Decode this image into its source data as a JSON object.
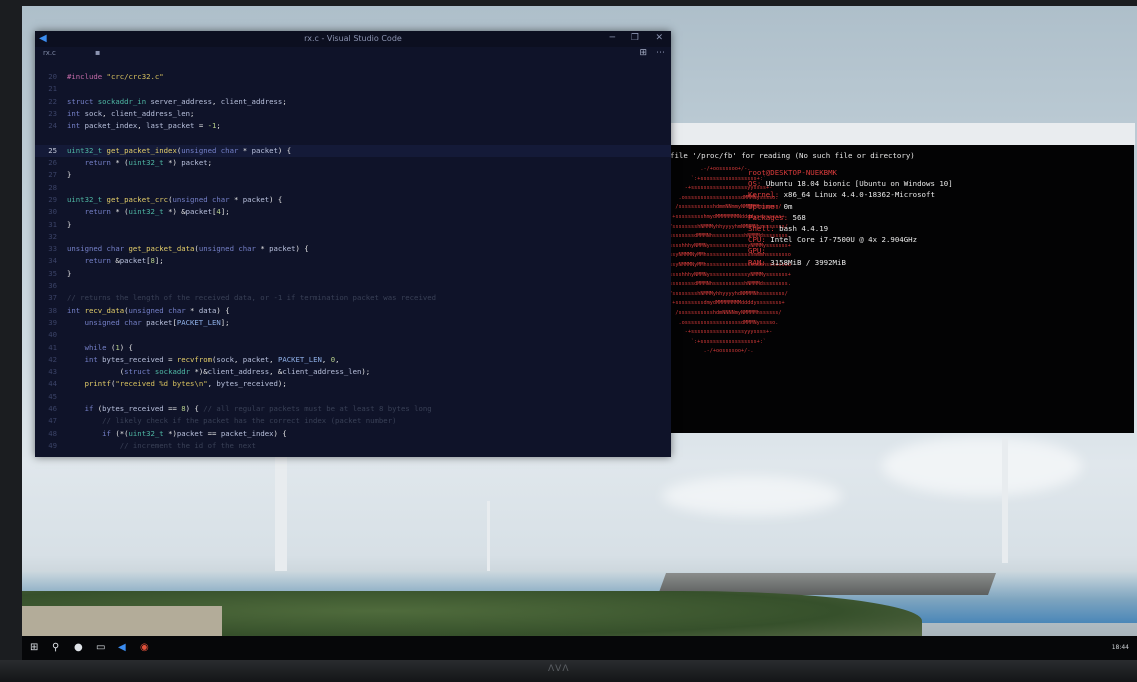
{
  "vscode": {
    "title": "rx.c - Visual Studio Code",
    "tab_label": "rx.c",
    "lines": [
      {
        "n": "20",
        "segs": [
          [
            "pre",
            "#include "
          ],
          [
            "str",
            "\"crc/crc32.c\""
          ]
        ]
      },
      {
        "n": "21",
        "segs": []
      },
      {
        "n": "22",
        "segs": [
          [
            "kw",
            "struct "
          ],
          [
            "ty",
            "sockaddr_in "
          ],
          [
            "var",
            "server_address"
          ],
          [
            "op",
            ", "
          ],
          [
            "var",
            "client_address"
          ],
          [
            "op",
            ";"
          ]
        ]
      },
      {
        "n": "23",
        "segs": [
          [
            "kw",
            "int "
          ],
          [
            "var",
            "sock"
          ],
          [
            "op",
            ", "
          ],
          [
            "var",
            "client_address_len"
          ],
          [
            "op",
            ";"
          ]
        ]
      },
      {
        "n": "24",
        "segs": [
          [
            "kw",
            "int "
          ],
          [
            "var",
            "packet_index"
          ],
          [
            "op",
            ", "
          ],
          [
            "var",
            "last_packet "
          ],
          [
            "op",
            "= "
          ],
          [
            "num",
            "-1"
          ],
          [
            "op",
            ";"
          ]
        ]
      },
      {
        "n": "",
        "segs": []
      },
      {
        "n": "25",
        "active": true,
        "segs": [
          [
            "ty",
            "uint32_t "
          ],
          [
            "fn",
            "get_packet_index"
          ],
          [
            "op",
            "("
          ],
          [
            "kw",
            "unsigned char "
          ],
          [
            "op",
            "* "
          ],
          [
            "var",
            "packet"
          ],
          [
            "op",
            ") {"
          ]
        ]
      },
      {
        "n": "26",
        "segs": [
          [
            "kw",
            "    return "
          ],
          [
            "op",
            "* ("
          ],
          [
            "ty",
            "uint32_t "
          ],
          [
            "op",
            "*) "
          ],
          [
            "var",
            "packet"
          ],
          [
            "op",
            ";"
          ]
        ]
      },
      {
        "n": "27",
        "segs": [
          [
            "op",
            "}"
          ]
        ]
      },
      {
        "n": "28",
        "segs": []
      },
      {
        "n": "29",
        "segs": [
          [
            "ty",
            "uint32_t "
          ],
          [
            "fn",
            "get_packet_crc"
          ],
          [
            "op",
            "("
          ],
          [
            "kw",
            "unsigned char "
          ],
          [
            "op",
            "* "
          ],
          [
            "var",
            "packet"
          ],
          [
            "op",
            ") {"
          ]
        ]
      },
      {
        "n": "30",
        "segs": [
          [
            "kw",
            "    return "
          ],
          [
            "op",
            "* ("
          ],
          [
            "ty",
            "uint32_t "
          ],
          [
            "op",
            "*) &"
          ],
          [
            "var",
            "packet"
          ],
          [
            "op",
            "["
          ],
          [
            "num",
            "4"
          ],
          [
            "op",
            "];"
          ]
        ]
      },
      {
        "n": "31",
        "segs": [
          [
            "op",
            "}"
          ]
        ]
      },
      {
        "n": "32",
        "segs": []
      },
      {
        "n": "33",
        "segs": [
          [
            "kw",
            "unsigned char "
          ],
          [
            "fn",
            "get_packet_data"
          ],
          [
            "op",
            "("
          ],
          [
            "kw",
            "unsigned char "
          ],
          [
            "op",
            "* "
          ],
          [
            "var",
            "packet"
          ],
          [
            "op",
            ") {"
          ]
        ]
      },
      {
        "n": "34",
        "segs": [
          [
            "kw",
            "    return "
          ],
          [
            "op",
            "&"
          ],
          [
            "var",
            "packet"
          ],
          [
            "op",
            "["
          ],
          [
            "num",
            "8"
          ],
          [
            "op",
            "];"
          ]
        ]
      },
      {
        "n": "35",
        "segs": [
          [
            "op",
            "}"
          ]
        ]
      },
      {
        "n": "36",
        "segs": []
      },
      {
        "n": "37",
        "segs": [
          [
            "cm",
            "// returns the length of the received data, or -1 if termination packet was received"
          ]
        ]
      },
      {
        "n": "38",
        "segs": [
          [
            "kw",
            "int "
          ],
          [
            "fn",
            "recv_data"
          ],
          [
            "op",
            "("
          ],
          [
            "kw",
            "unsigned char "
          ],
          [
            "op",
            "* "
          ],
          [
            "var",
            "data"
          ],
          [
            "op",
            ") {"
          ]
        ]
      },
      {
        "n": "39",
        "segs": [
          [
            "kw",
            "    unsigned char "
          ],
          [
            "var",
            "packet"
          ],
          [
            "op",
            "["
          ],
          [
            "mac",
            "PACKET_LEN"
          ],
          [
            "op",
            "];"
          ]
        ]
      },
      {
        "n": "40",
        "segs": []
      },
      {
        "n": "41",
        "segs": [
          [
            "kw",
            "    while "
          ],
          [
            "op",
            "("
          ],
          [
            "num",
            "1"
          ],
          [
            "op",
            ") {"
          ]
        ]
      },
      {
        "n": "42",
        "segs": [
          [
            "kw",
            "    int "
          ],
          [
            "var",
            "bytes_received "
          ],
          [
            "op",
            "= "
          ],
          [
            "fn",
            "recvfrom"
          ],
          [
            "op",
            "("
          ],
          [
            "var",
            "sock"
          ],
          [
            "op",
            ", "
          ],
          [
            "var",
            "packet"
          ],
          [
            "op",
            ", "
          ],
          [
            "mac",
            "PACKET_LEN"
          ],
          [
            "op",
            ", "
          ],
          [
            "num",
            "0"
          ],
          [
            "op",
            ","
          ]
        ]
      },
      {
        "n": "43",
        "segs": [
          [
            "op",
            "            ("
          ],
          [
            "kw",
            "struct "
          ],
          [
            "ty",
            "sockaddr "
          ],
          [
            "op",
            "*)&"
          ],
          [
            "var",
            "client_address"
          ],
          [
            "op",
            ", &"
          ],
          [
            "var",
            "client_address_len"
          ],
          [
            "op",
            ");"
          ]
        ]
      },
      {
        "n": "44",
        "segs": [
          [
            "fn",
            "    printf"
          ],
          [
            "op",
            "("
          ],
          [
            "str",
            "\"received %d bytes\\n\""
          ],
          [
            "op",
            ", "
          ],
          [
            "var",
            "bytes_received"
          ],
          [
            "op",
            ");"
          ]
        ]
      },
      {
        "n": "45",
        "segs": []
      },
      {
        "n": "46",
        "segs": [
          [
            "kw",
            "    if "
          ],
          [
            "op",
            "("
          ],
          [
            "var",
            "bytes_received "
          ],
          [
            "op",
            "== "
          ],
          [
            "num",
            "8"
          ],
          [
            "op",
            ") { "
          ],
          [
            "cm",
            "// all regular packets must be at least 8 bytes long"
          ]
        ]
      },
      {
        "n": "47",
        "segs": [
          [
            "cm",
            "        // likely check if the packet has the correct index (packet number)"
          ]
        ]
      },
      {
        "n": "48",
        "segs": [
          [
            "kw",
            "        if "
          ],
          [
            "op",
            "(*("
          ],
          [
            "ty",
            "uint32_t "
          ],
          [
            "op",
            "*)"
          ],
          [
            "var",
            "packet "
          ],
          [
            "op",
            "== "
          ],
          [
            "var",
            "packet_index"
          ],
          [
            "op",
            ") {"
          ]
        ]
      },
      {
        "n": "49",
        "segs": [
          [
            "cm",
            "            // increment the id of the next"
          ]
        ]
      }
    ]
  },
  "terminal": {
    "error_line": "file '/proc/fb' for reading (No such file or directory)",
    "logo": [
      {
        "t": "           .-/+oossssoo+/-.",
        "c": "red"
      },
      {
        "t": "        `:+ssssssssssssssssss+:`",
        "c": "red"
      },
      {
        "t": "      -+ssssssssssssssssssyyssss+-",
        "c": "red"
      },
      {
        "t": "    .ossssssssssssssssssdMMMNysssso.",
        "c": "red"
      },
      {
        "t": "   /ssssssssssshdmmNNmmyNMMMMhssssss/",
        "c": "red"
      },
      {
        "t": "  +ssssssssshmydMMMMMMMNddddyssssssss+",
        "c": "red"
      },
      {
        "t": " /sssssssshNMMMyhhyyyyhmNMMMNhssssssss/",
        "c": "red"
      },
      {
        "t": ".ssssssssdMMMNhsssssssssshNMMMdssssssss.",
        "c": "red"
      },
      {
        "t": "+sssshhhyNMMNyssssssssssssyNMMMysssssss+",
        "c": "red"
      },
      {
        "t": "ossyNMMMNyMMhsssssssssssssshmmmhssssssso",
        "c": "red"
      },
      {
        "t": "ossyNMMMNyMMhsssssssssssssshmmmhssssssso",
        "c": "red"
      },
      {
        "t": "+sssshhhyNMMNyssssssssssssyNMMMysssssss+",
        "c": "red"
      },
      {
        "t": ".ssssssssdMMMNhsssssssssshNMMMdssssssss.",
        "c": "red"
      },
      {
        "t": " /sssssssshNMMMyhhyyyyhdNMMMNhssssssss/",
        "c": "red"
      },
      {
        "t": "  +sssssssssdmydMMMMMMMMddddyssssssss+",
        "c": "red"
      },
      {
        "t": "   /ssssssssssshdmNNNNmyNMMMMhssssss/",
        "c": "red"
      },
      {
        "t": "    .ossssssssssssssssssdMMMNysssso.",
        "c": "red"
      },
      {
        "t": "      -+sssssssssssssssssyyyssss+-",
        "c": "red"
      },
      {
        "t": "        `:+ssssssssssssssssss+:`",
        "c": "red"
      },
      {
        "t": "            .-/+oossssoo+/-.",
        "c": "red"
      }
    ],
    "info": [
      {
        "k": "",
        "v": "root@DESKTOP-NUEKBMK"
      },
      {
        "k": "OS: ",
        "v": "Ubuntu 18.04 bionic [Ubuntu on Windows 10]"
      },
      {
        "k": "Kernel: ",
        "v": "x86_64 Linux 4.4.0-18362-Microsoft"
      },
      {
        "k": "Uptime: ",
        "v": "0m"
      },
      {
        "k": "Packages: ",
        "v": "568"
      },
      {
        "k": "Shell: ",
        "v": "bash 4.4.19"
      },
      {
        "k": "CPU: ",
        "v": "Intel Core i7-7500U @ 4x 2.904GHz"
      },
      {
        "k": "GPU: ",
        "v": ""
      },
      {
        "k": "RAM: ",
        "v": "3158MiB / 3992MiB"
      }
    ]
  },
  "taskbar": {
    "icons": [
      "windows-start-icon",
      "search-icon",
      "cortana-icon",
      "task-view-icon",
      "vscode-taskbar-icon",
      "chrome-taskbar-icon"
    ],
    "clock": "18:44"
  },
  "colors": {
    "editor_bg": "#0f1329",
    "terminal_bg": "#030304",
    "ubuntu_red": "#d93b3b"
  }
}
